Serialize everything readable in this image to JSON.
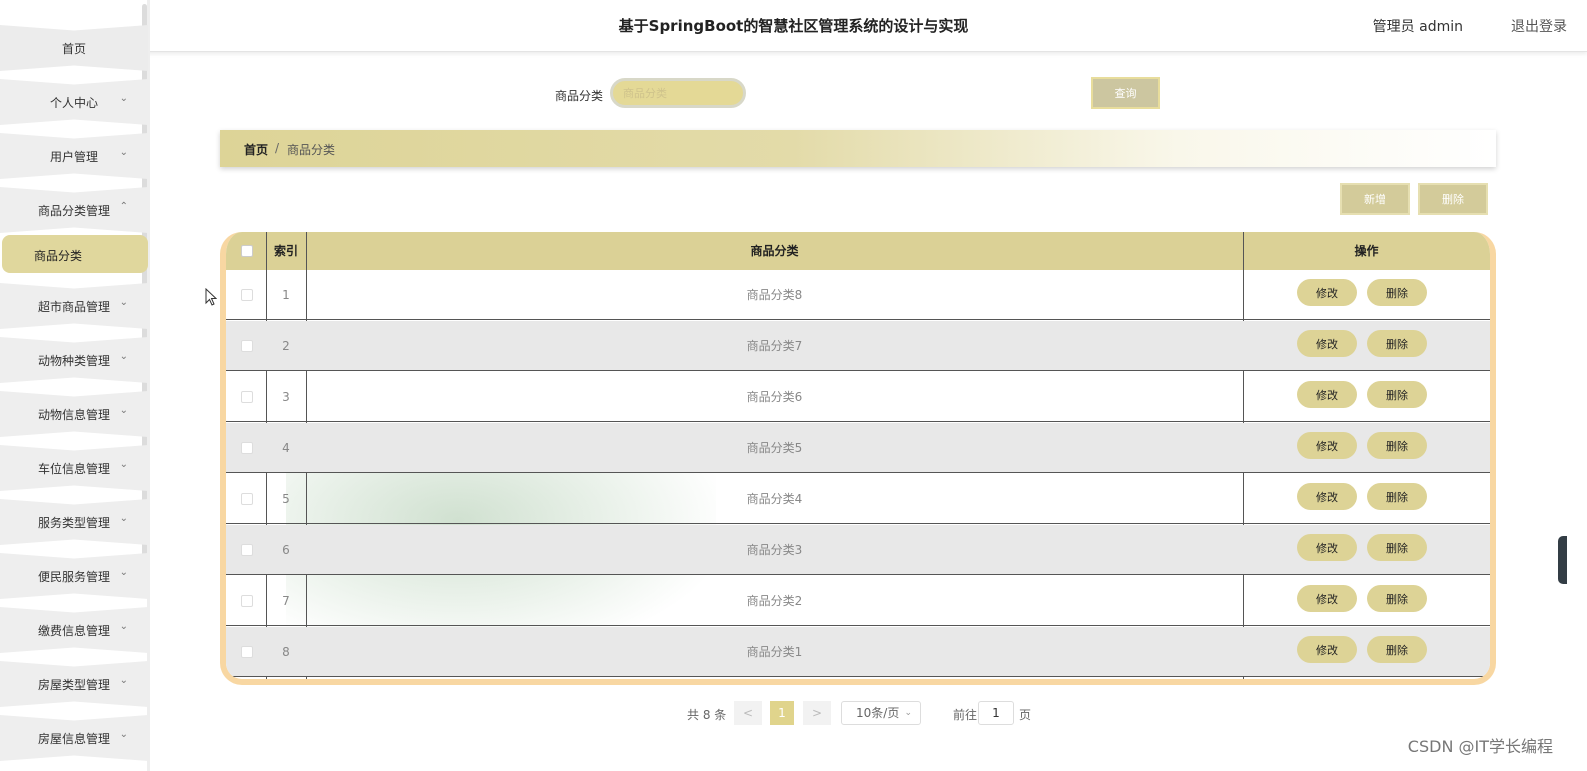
{
  "header": {
    "title": "基于SpringBoot的智慧社区管理系统的设计与实现",
    "user": "管理员 admin",
    "logout": "退出登录"
  },
  "sidebar": {
    "items": [
      {
        "label": "首页",
        "has_chevron": false
      },
      {
        "label": "个人中心",
        "chevron": "⌄"
      },
      {
        "label": "用户管理",
        "chevron": "⌄"
      },
      {
        "label": "商品分类管理",
        "chevron": "⌃",
        "expanded": true
      },
      {
        "label": "超市商品管理",
        "chevron": "⌄"
      },
      {
        "label": "动物种类管理",
        "chevron": "⌄"
      },
      {
        "label": "动物信息管理",
        "chevron": "⌄"
      },
      {
        "label": "车位信息管理",
        "chevron": "⌄"
      },
      {
        "label": "服务类型管理",
        "chevron": "⌄"
      },
      {
        "label": "便民服务管理",
        "chevron": "⌄"
      },
      {
        "label": "缴费信息管理",
        "chevron": "⌄"
      },
      {
        "label": "房屋类型管理",
        "chevron": "⌄"
      },
      {
        "label": "房屋信息管理",
        "chevron": "⌄"
      }
    ],
    "active_subitem": "商品分类"
  },
  "search": {
    "label": "商品分类",
    "placeholder": "商品分类",
    "button": "查询"
  },
  "breadcrumb": {
    "home": "首页",
    "separator": "/",
    "current": "商品分类"
  },
  "actions": {
    "add": "新增",
    "delete": "删除"
  },
  "table": {
    "columns": [
      "",
      "索引",
      "商品分类",
      "操作"
    ],
    "rows": [
      {
        "index": "1",
        "name": "商品分类8"
      },
      {
        "index": "2",
        "name": "商品分类7"
      },
      {
        "index": "3",
        "name": "商品分类6"
      },
      {
        "index": "4",
        "name": "商品分类5"
      },
      {
        "index": "5",
        "name": "商品分类4"
      },
      {
        "index": "6",
        "name": "商品分类3"
      },
      {
        "index": "7",
        "name": "商品分类2"
      },
      {
        "index": "8",
        "name": "商品分类1"
      }
    ],
    "row_actions": {
      "edit": "修改",
      "delete": "删除"
    }
  },
  "pagination": {
    "total": "共 8 条",
    "prev": "<",
    "current_page": "1",
    "next": ">",
    "page_size": "10条/页",
    "goto_label": "前往",
    "goto_value": "1",
    "goto_unit": "页"
  },
  "watermark": "CSDN @IT学长编程",
  "colors": {
    "accent": "#dbd196",
    "table_border": "#f8d7a2",
    "active_menu": "#e0d79d",
    "stripe": "#e8e8e8"
  }
}
